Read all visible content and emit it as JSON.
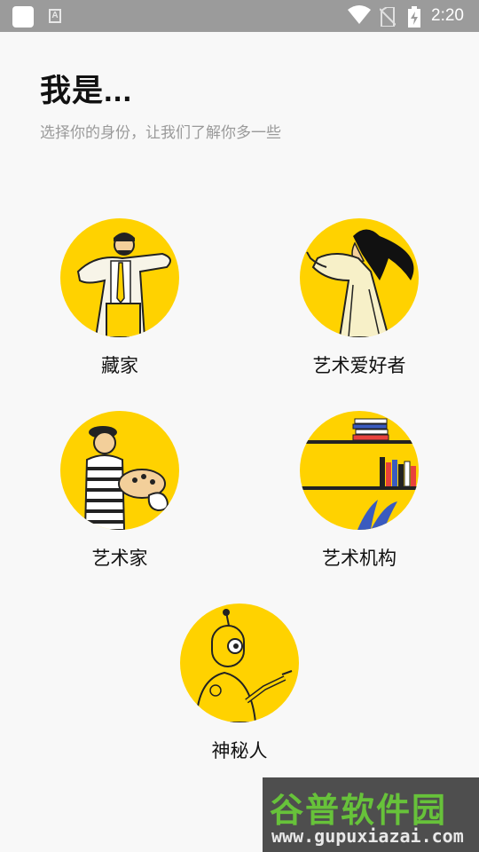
{
  "status_bar": {
    "time": "2:20",
    "a_icon_letter": "A"
  },
  "header": {
    "title": "我是...",
    "subtitle": "选择你的身份，让我们了解你多一些"
  },
  "roles": [
    {
      "label": "藏家",
      "icon": "collector-illustration-icon"
    },
    {
      "label": "艺术爱好者",
      "icon": "art-lover-illustration-icon"
    },
    {
      "label": "艺术家",
      "icon": "artist-illustration-icon"
    },
    {
      "label": "艺术机构",
      "icon": "institution-illustration-icon"
    },
    {
      "label": "神秘人",
      "icon": "mystery-robot-illustration-icon"
    }
  ],
  "watermark": {
    "name": "谷普软件园",
    "url": "www.gupuxiazai.com"
  },
  "colors": {
    "accent": "#ffd200",
    "background": "#f8f8f8",
    "status_bar": "#9b9b9b"
  }
}
